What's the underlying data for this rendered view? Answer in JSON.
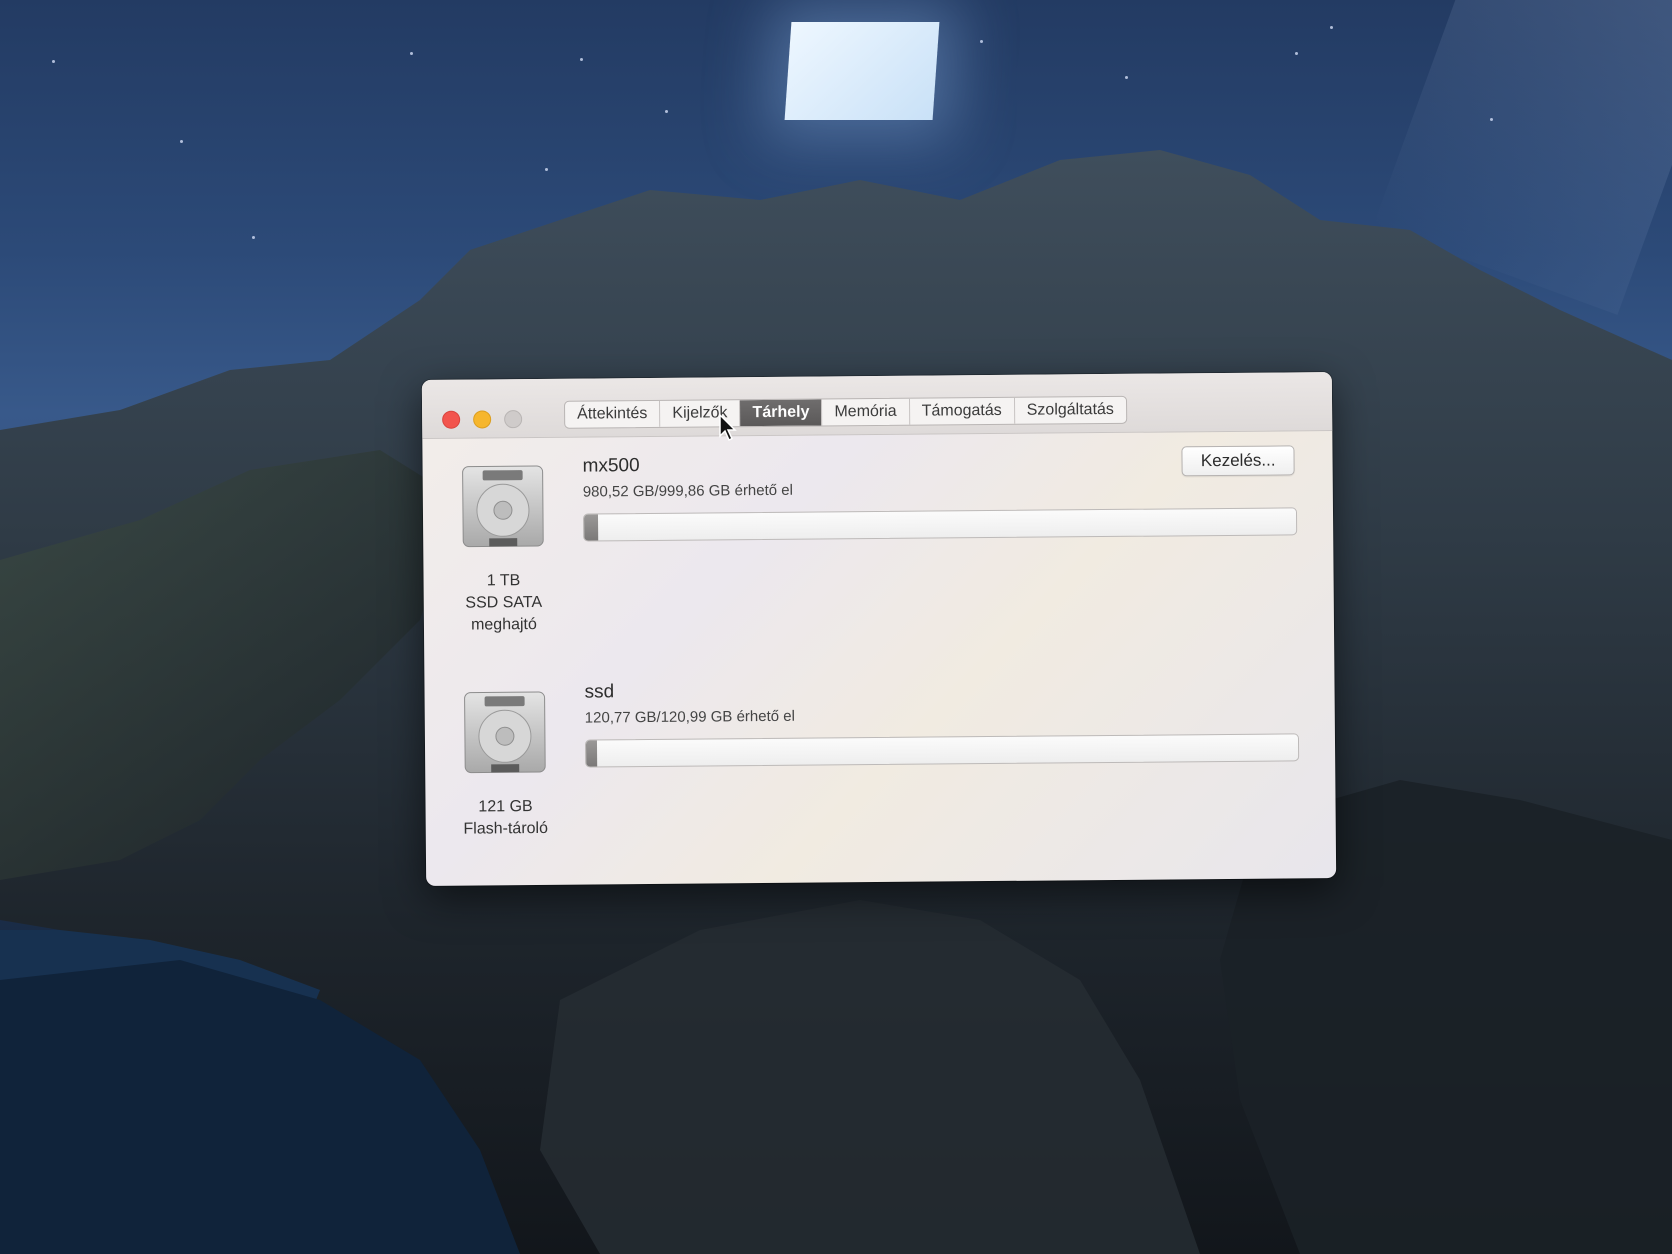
{
  "window": {
    "tabs": [
      {
        "label": "Áttekintés",
        "active": false
      },
      {
        "label": "Kijelzők",
        "active": false
      },
      {
        "label": "Tárhely",
        "active": true
      },
      {
        "label": "Memória",
        "active": false
      },
      {
        "label": "Támogatás",
        "active": false
      },
      {
        "label": "Szolgáltatás",
        "active": false
      }
    ]
  },
  "drives": [
    {
      "name": "mx500",
      "available": "980,52 GB/999,86 GB érhető el",
      "caption_line1": "1 TB",
      "caption_line2": "SSD SATA",
      "caption_line3": "meghajtó",
      "used_fraction": 0.02,
      "icon": "hard-drive-icon"
    },
    {
      "name": "ssd",
      "available": "120,77 GB/120,99 GB érhető el",
      "caption_line1": "121 GB",
      "caption_line2": "Flash-tároló",
      "caption_line3": "",
      "used_fraction": 0.002,
      "icon": "hard-drive-icon"
    }
  ],
  "manage_button": {
    "label": "Kezelés..."
  },
  "colors": {
    "close": "#f2544d",
    "minimize": "#f6b62d",
    "zoom_inactive": "#cfcbca",
    "active_tab": "#5f5d5d"
  }
}
